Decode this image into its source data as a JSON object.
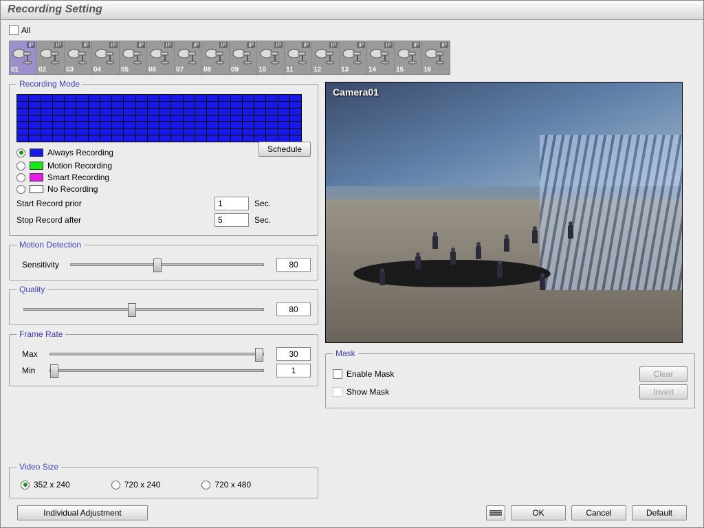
{
  "window": {
    "title": "Recording Setting"
  },
  "all_checkbox": {
    "label": "All",
    "checked": false
  },
  "cameras": [
    "01",
    "02",
    "03",
    "04",
    "05",
    "06",
    "07",
    "08",
    "09",
    "10",
    "11",
    "12",
    "13",
    "14",
    "15",
    "16"
  ],
  "camera_selected": "01",
  "camera_ip_label": "IP",
  "recording_mode": {
    "legend": "Recording Mode",
    "schedule_button": "Schedule",
    "options": {
      "always": "Always Recording",
      "motion": "Motion Recording",
      "smart": "Smart Recording",
      "none": "No Recording"
    },
    "selected": "always",
    "start_prior": {
      "label": "Start Record prior",
      "value": "1",
      "unit": "Sec."
    },
    "stop_after": {
      "label": "Stop Record after",
      "value": "5",
      "unit": "Sec."
    }
  },
  "motion_detection": {
    "legend": "Motion Detection",
    "sensitivity_label": "Sensitivity",
    "sensitivity_value": "80"
  },
  "quality": {
    "legend": "Quality",
    "value": "80"
  },
  "frame_rate": {
    "legend": "Frame Rate",
    "max_label": "Max",
    "max_value": "30",
    "min_label": "Min",
    "min_value": "1"
  },
  "preview": {
    "label": "Camera01"
  },
  "mask": {
    "legend": "Mask",
    "enable_label": "Enable Mask",
    "show_label": "Show Mask",
    "clear_button": "Clear",
    "invert_button": "Invert"
  },
  "video_size": {
    "legend": "Video Size",
    "options": {
      "a": "352 x 240",
      "b": "720 x 240",
      "c": "720 x 480"
    },
    "selected": "a"
  },
  "buttons": {
    "individual": "Individual Adjustment",
    "ok": "OK",
    "cancel": "Cancel",
    "default": "Default"
  }
}
